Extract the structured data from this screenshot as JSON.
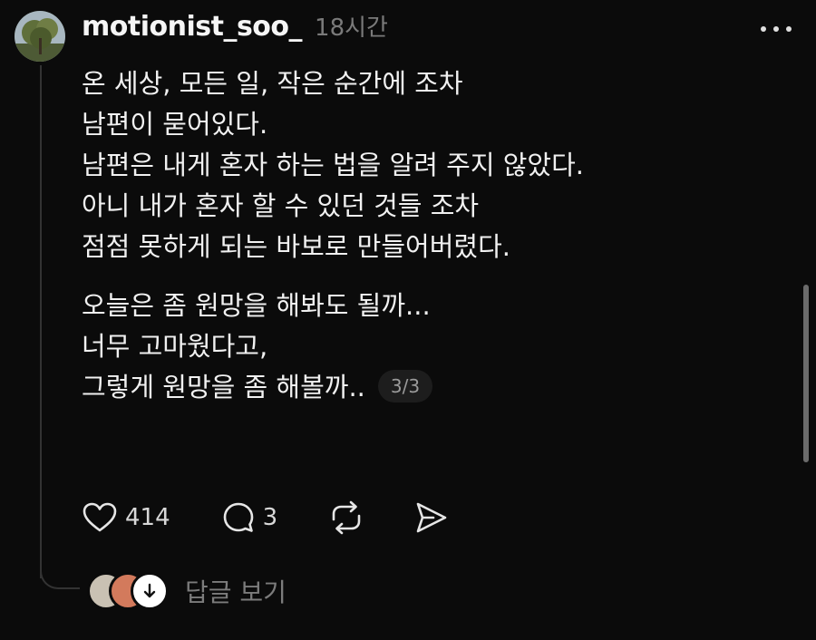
{
  "post": {
    "username": "motionist_soo_",
    "timestamp": "18시간",
    "paragraph1": [
      "온 세상, 모든 일, 작은 순간에 조차",
      "남편이 묻어있다.",
      "남편은 내게 혼자 하는 법을 알려 주지 않았다.",
      "아니 내가 혼자 할 수 있던 것들 조차",
      "점점 못하게 되는 바보로 만들어버렸다."
    ],
    "paragraph2": [
      "오늘은 좀 원망을 해봐도 될까...",
      "너무 고마웠다고,",
      "그렇게 원망을 좀 해볼까.."
    ],
    "page_counter": "3/3"
  },
  "actions": {
    "like_count": "414",
    "comment_count": "3"
  },
  "replies": {
    "label": "답글 보기"
  },
  "colors": {
    "background": "#0b0b0b",
    "text": "#f1f1f1",
    "muted": "#7a7a7a",
    "thread_line": "#333333"
  },
  "icons": [
    "more-icon",
    "heart-icon",
    "comment-icon",
    "repost-icon",
    "share-icon",
    "arrow-down-icon"
  ]
}
